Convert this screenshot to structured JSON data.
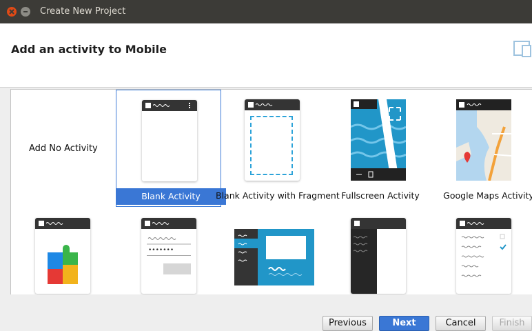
{
  "window": {
    "title": "Create New Project"
  },
  "header": {
    "title": "Add an activity to Mobile"
  },
  "gallery": {
    "no_activity_label": "Add No Activity",
    "tiles": [
      {
        "label": "Blank Activity",
        "selected": true
      },
      {
        "label": "Blank Activity with Fragment",
        "selected": false
      },
      {
        "label": "Fullscreen Activity",
        "selected": false
      },
      {
        "label": "Google Maps Activity",
        "selected": false
      }
    ],
    "login_password_mask": "•••••••"
  },
  "footer": {
    "previous": "Previous",
    "next": "Next",
    "cancel": "Cancel",
    "finish": "Finish"
  },
  "colors": {
    "accent": "#3a77d5",
    "titlebar": "#3c3b37",
    "close": "#df4a16"
  }
}
